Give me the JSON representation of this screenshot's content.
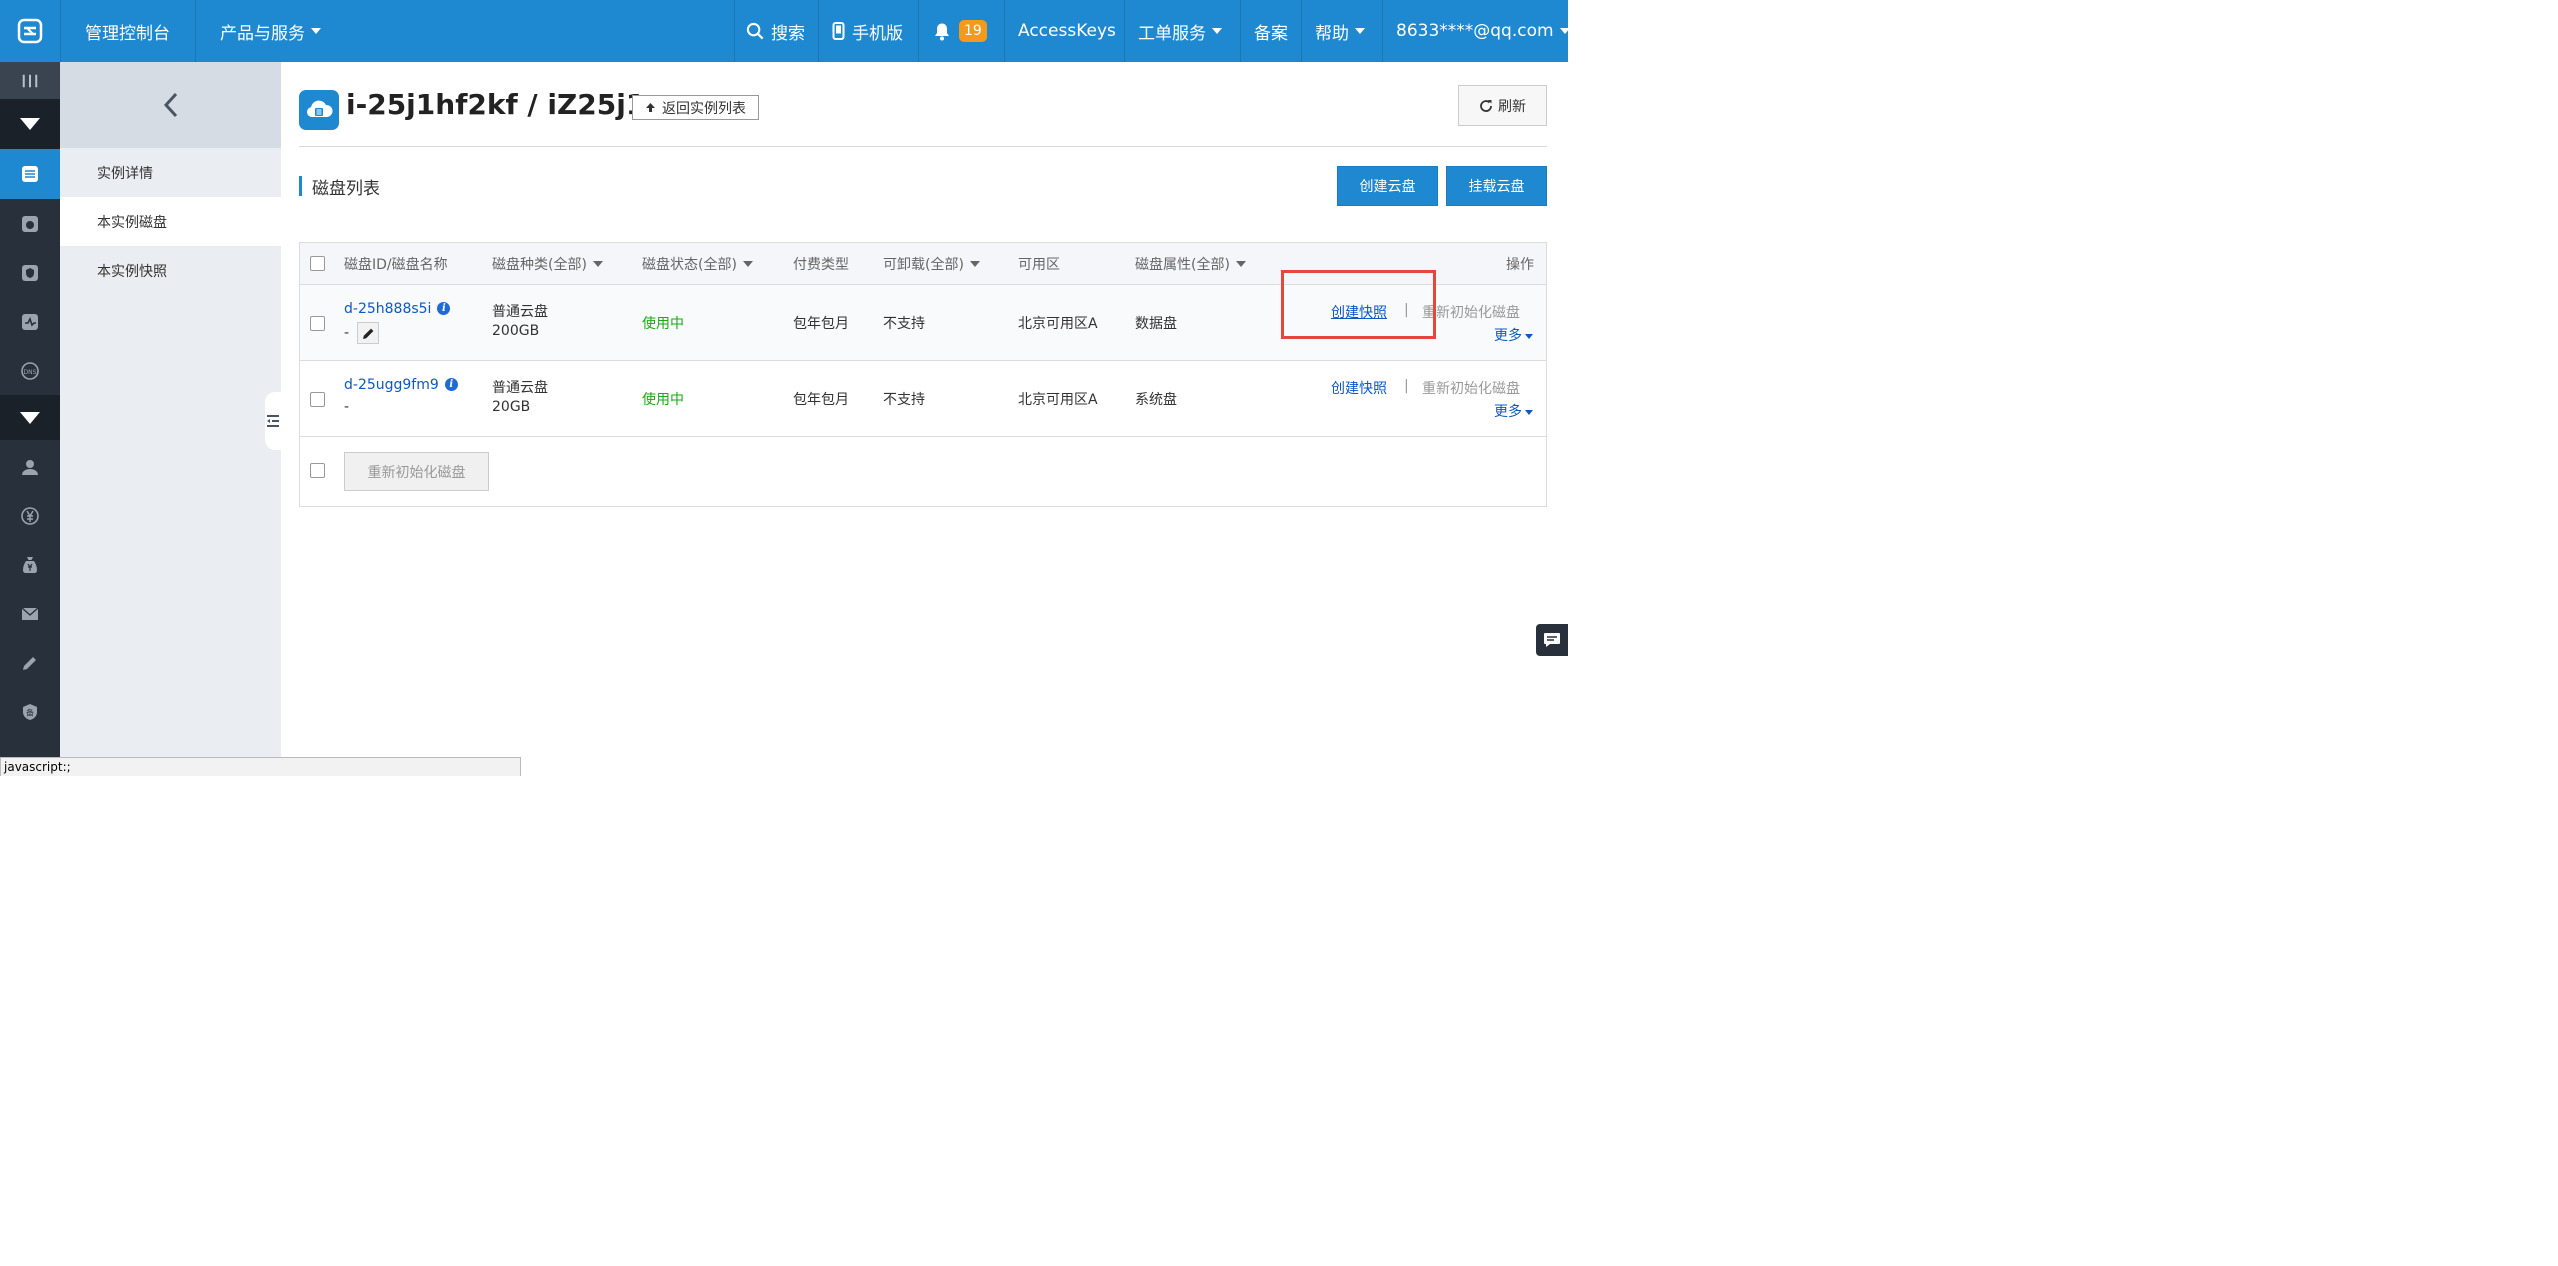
{
  "topbar": {
    "console_label": "管理控制台",
    "products_label": "产品与服务",
    "search_label": "搜索",
    "mobile_label": "手机版",
    "notification_count": "19",
    "accesskeys_label": "AccessKeys",
    "ticket_label": "工单服务",
    "beian_label": "备案",
    "help_label": "帮助",
    "account_label": "8633****@qq.com"
  },
  "subnav": {
    "items": [
      {
        "label": "实例详情"
      },
      {
        "label": "本实例磁盘"
      },
      {
        "label": "本实例快照"
      }
    ]
  },
  "header": {
    "title": "i-25j1hf2kf / iZ25j1...",
    "back_label": "返回实例列表",
    "refresh_label": "刷新"
  },
  "section": {
    "title": "磁盘列表",
    "create_disk_label": "创建云盘",
    "attach_disk_label": "挂载云盘"
  },
  "table": {
    "columns": {
      "id": "磁盘ID/磁盘名称",
      "type": "磁盘种类(全部)",
      "status": "磁盘状态(全部)",
      "billing": "付费类型",
      "detachable": "可卸载(全部)",
      "zone": "可用区",
      "attribute": "磁盘属性(全部)",
      "actions": "操作"
    },
    "rows": [
      {
        "id": "d-25h888s5i",
        "name": "-",
        "type": "普通云盘",
        "size": "200GB",
        "status": "使用中",
        "billing": "包年包月",
        "detachable": "不支持",
        "zone": "北京可用区A",
        "attribute": "数据盘",
        "action_snapshot": "创建快照",
        "action_reinit": "重新初始化磁盘",
        "action_more": "更多"
      },
      {
        "id": "d-25ugg9fm9",
        "name": "-",
        "type": "普通云盘",
        "size": "20GB",
        "status": "使用中",
        "billing": "包年包月",
        "detachable": "不支持",
        "zone": "北京可用区A",
        "attribute": "系统盘",
        "action_snapshot": "创建快照",
        "action_reinit": "重新初始化磁盘",
        "action_more": "更多"
      }
    ],
    "batch_reinit_label": "重新初始化磁盘"
  },
  "statusbar": {
    "text": "javascript:;"
  },
  "colors": {
    "brand": "#1e89d1",
    "sidebar": "#28303b",
    "status_green": "#1aab12",
    "link": "#0c58c4",
    "highlight": "#e8453c",
    "badge": "#f39a1c"
  }
}
